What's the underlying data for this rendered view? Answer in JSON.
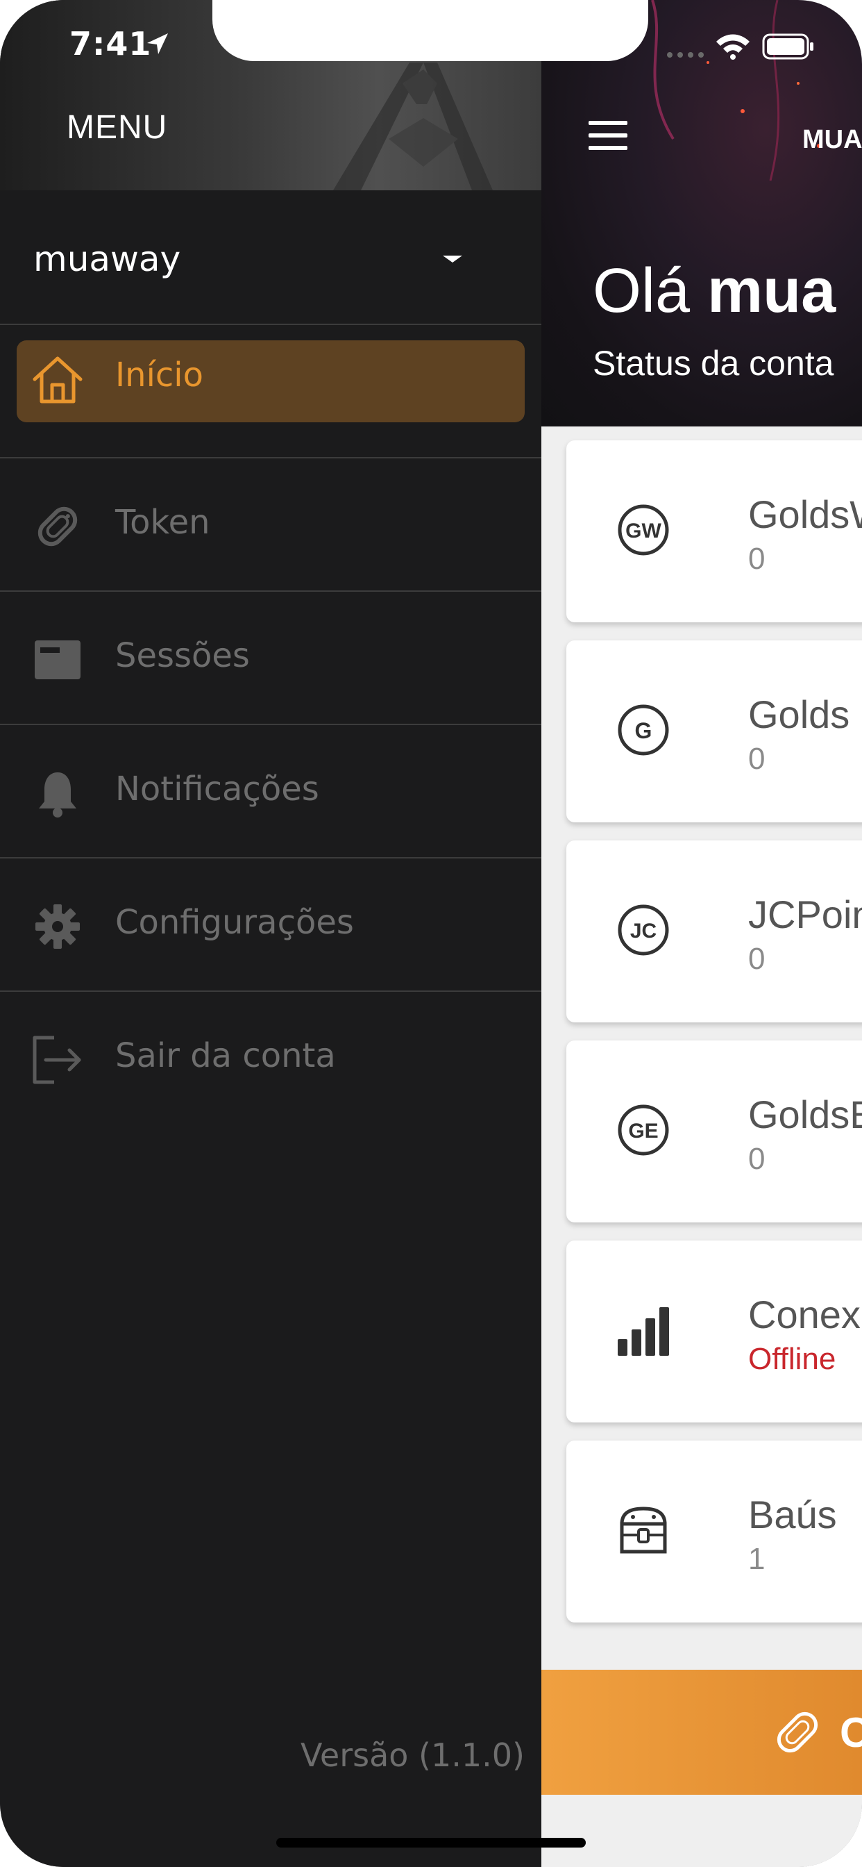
{
  "status_bar": {
    "time": "7:41"
  },
  "drawer": {
    "title": "MENU",
    "account_name": "muaway",
    "items": [
      {
        "label": "Início",
        "icon": "home-icon",
        "active": true
      },
      {
        "label": "Token",
        "icon": "token-icon",
        "active": false
      },
      {
        "label": "Sessões",
        "icon": "sessions-icon",
        "active": false
      },
      {
        "label": "Notificações",
        "icon": "bell-icon",
        "active": false
      },
      {
        "label": "Configurações",
        "icon": "gear-icon",
        "active": false
      },
      {
        "label": "Sair da conta",
        "icon": "logout-icon",
        "active": false
      }
    ],
    "version": "Versão (1.1.0)"
  },
  "main": {
    "brand": "MUA",
    "greeting_prefix": "Olá",
    "greeting_name": "mua",
    "subtitle": "Status da conta",
    "cards": [
      {
        "title": "GoldsW",
        "value": "0",
        "icon": "gw-badge-icon",
        "badge": "GW"
      },
      {
        "title": "Golds",
        "value": "0",
        "icon": "g-badge-icon",
        "badge": "G"
      },
      {
        "title": "JCPoin",
        "value": "0",
        "icon": "jc-badge-icon",
        "badge": "JC"
      },
      {
        "title": "GoldsE",
        "value": "0",
        "icon": "ge-badge-icon",
        "badge": "GE"
      },
      {
        "title": "Conex",
        "value": "Offline",
        "icon": "signal-bars-icon"
      },
      {
        "title": "Baús",
        "value": "1",
        "icon": "chest-icon"
      }
    ],
    "cta_label": "C"
  },
  "colors": {
    "accent": "#e9962e",
    "active_bg": "#5e4222",
    "drawer_bg": "#1b1b1c",
    "offline": "#c9262c",
    "cta": "#f0a040"
  }
}
